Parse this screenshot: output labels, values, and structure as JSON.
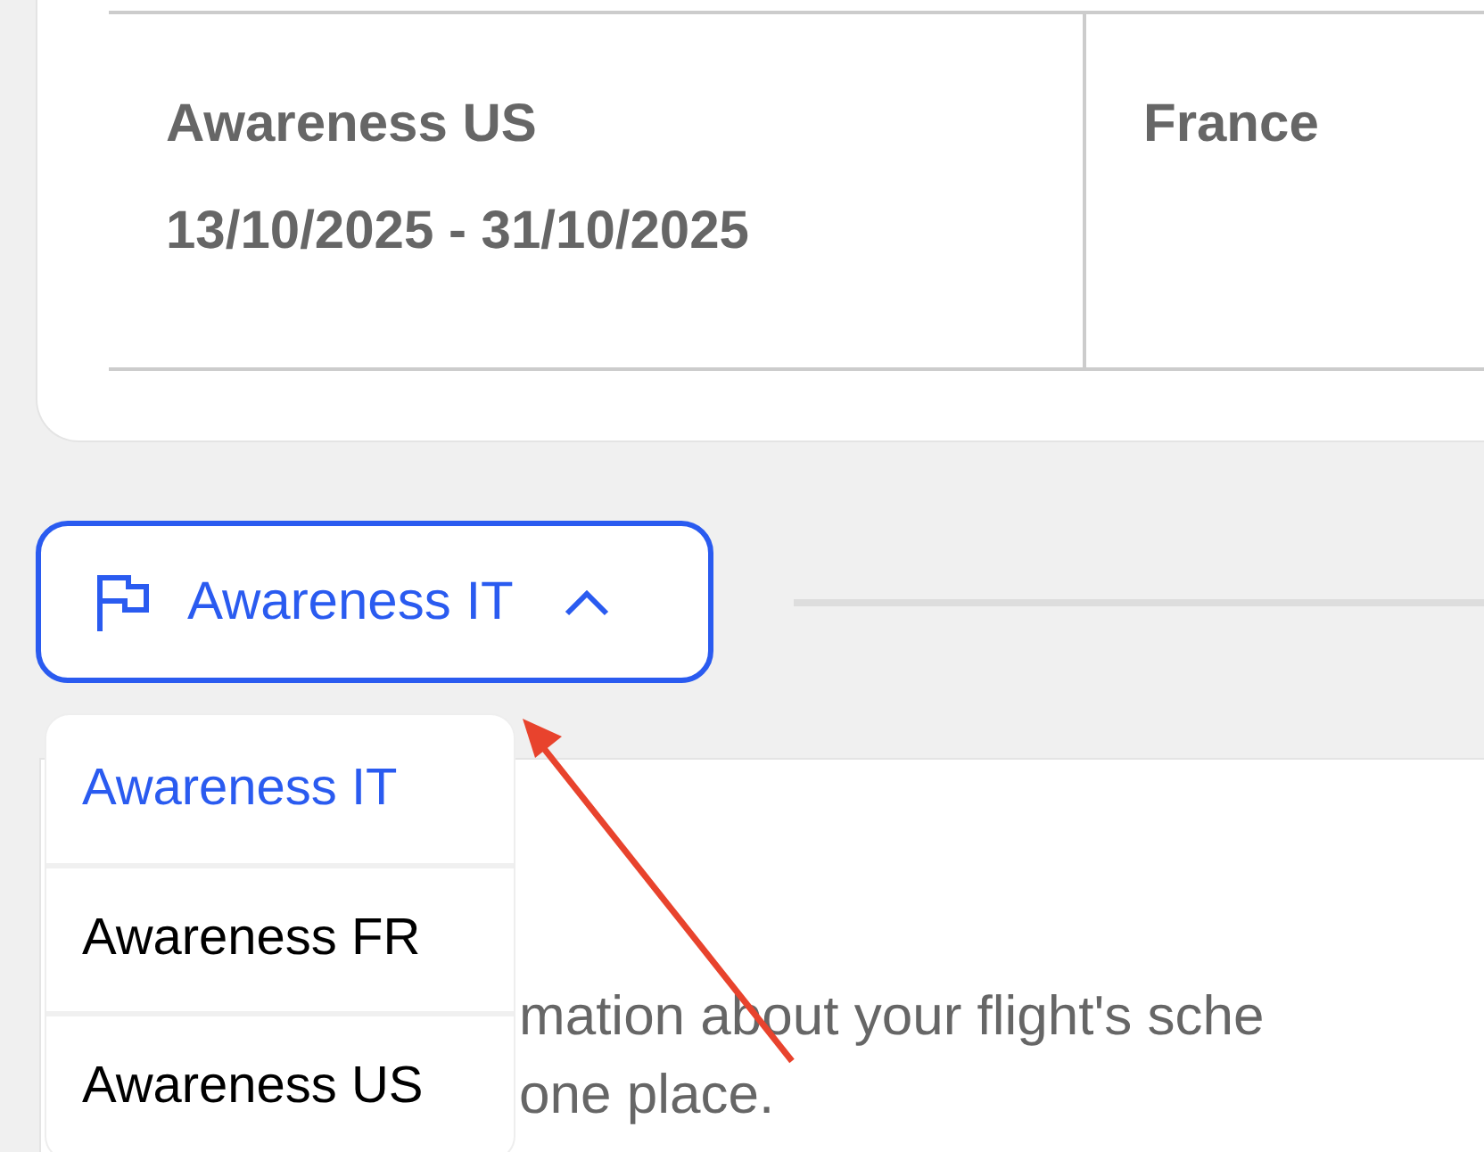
{
  "table": {
    "rows": [
      {
        "cells": [
          {
            "title": "Awareness US",
            "dates": "13/10/2025 - 31/10/2025"
          },
          {
            "title": "France"
          }
        ]
      }
    ]
  },
  "campaign_select": {
    "value": "Awareness IT",
    "expanded": true,
    "options": [
      {
        "label": "Awareness IT",
        "selected": true
      },
      {
        "label": "Awareness FR",
        "selected": false
      },
      {
        "label": "Awareness US",
        "selected": false
      }
    ]
  },
  "info_panel": {
    "lines": [
      "mation about your flight's sche",
      "one place."
    ]
  }
}
